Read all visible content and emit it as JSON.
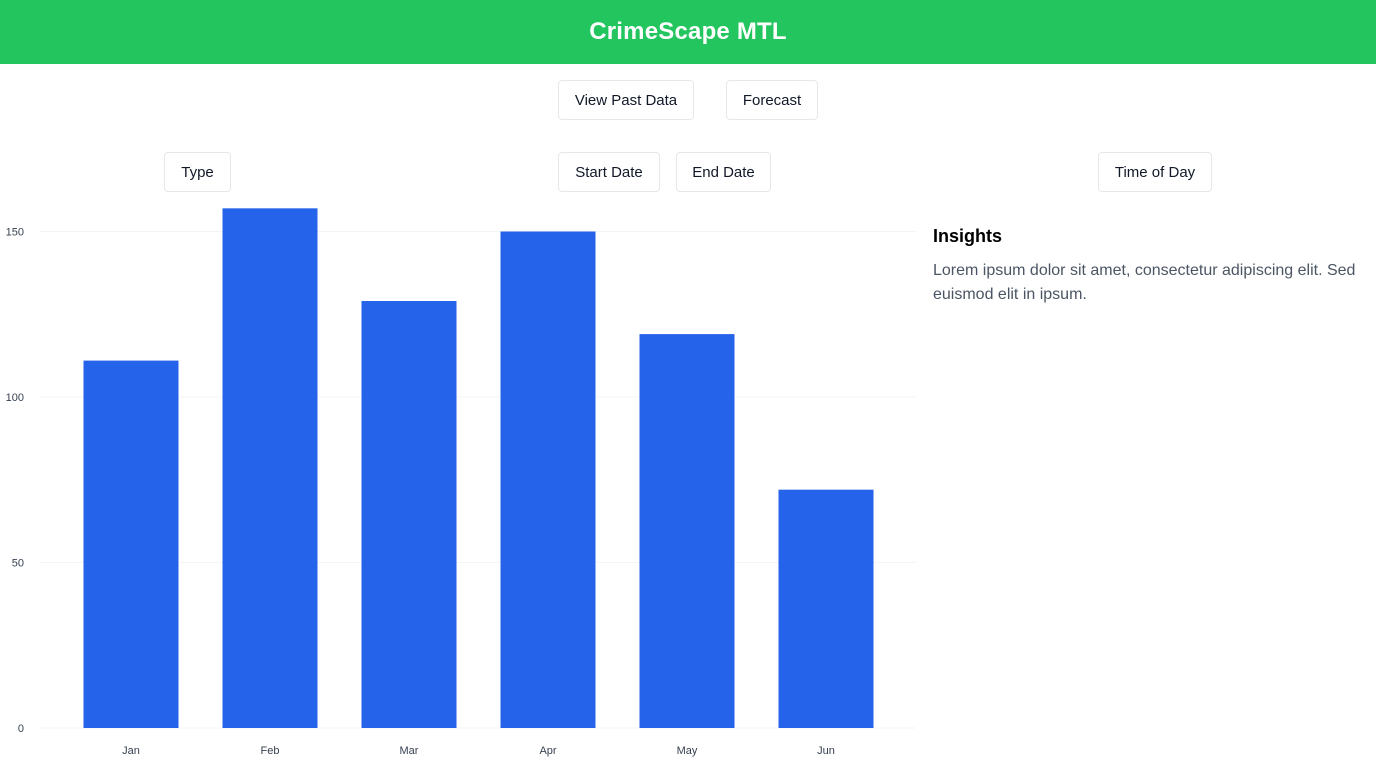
{
  "header": {
    "title": "CrimeScape MTL"
  },
  "nav": {
    "view_past_label": "View Past Data",
    "forecast_label": "Forecast"
  },
  "filters": {
    "type_label": "Type",
    "start_date_label": "Start Date",
    "end_date_label": "End Date",
    "time_of_day_label": "Time of Day"
  },
  "insights": {
    "title": "Insights",
    "text": "Lorem ipsum dolor sit amet, consectetur adipiscing elit. Sed euismod elit in ipsum."
  },
  "colors": {
    "header_bg": "#22c55e",
    "bar": "#2563eb",
    "grid": "#f3f4f6"
  },
  "chart_data": {
    "type": "bar",
    "categories": [
      "Jan",
      "Feb",
      "Mar",
      "Apr",
      "May",
      "Jun"
    ],
    "values": [
      111,
      157,
      129,
      150,
      119,
      72
    ],
    "yticks": [
      0,
      50,
      100,
      150
    ],
    "ylim": [
      0,
      157
    ],
    "grid": true,
    "title": "",
    "xlabel": "",
    "ylabel": ""
  }
}
